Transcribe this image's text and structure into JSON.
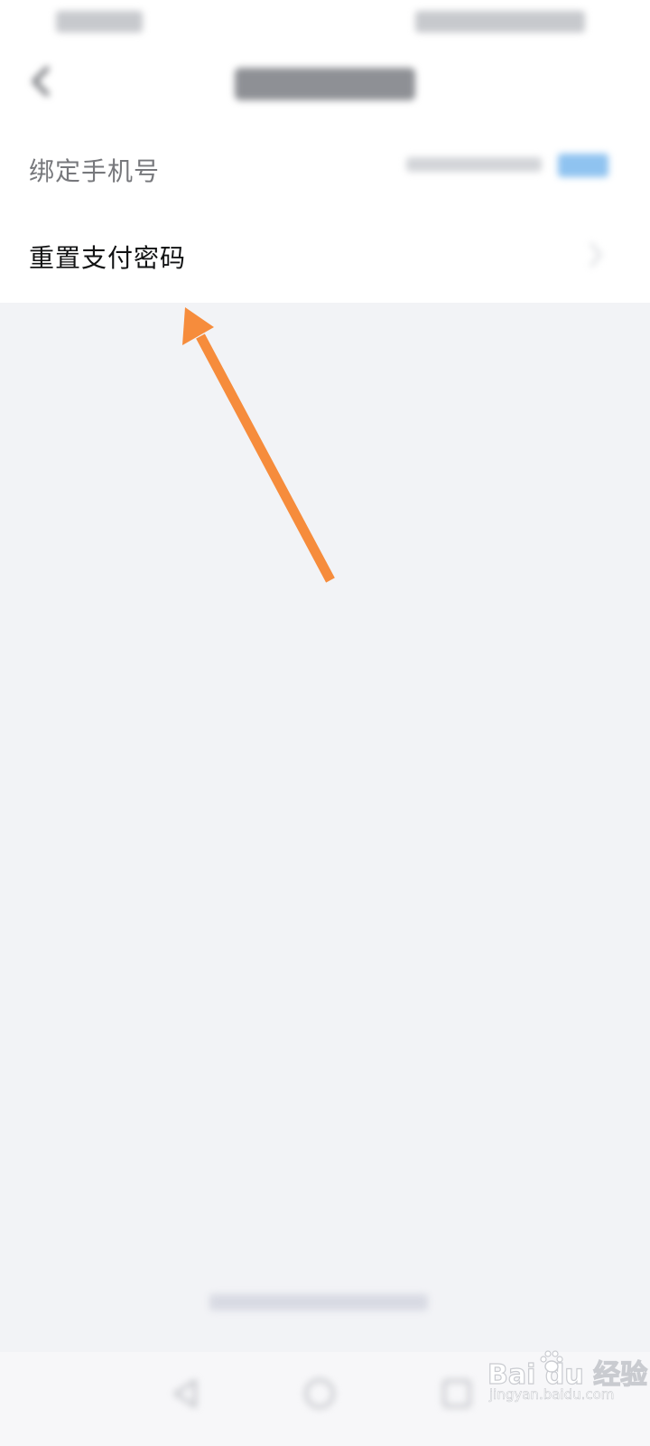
{
  "settings": {
    "bind_phone_label": "绑定手机号",
    "reset_pay_password_label": "重置支付密码"
  },
  "watermark": {
    "brand_text": "Bai du 经验",
    "url_text": "jingyan.baidu.com"
  },
  "icons": {
    "back": "chevron-left-icon",
    "row_arrow": "chevron-right-icon",
    "annotation": "arrow-icon",
    "nav_back": "triangle-back-icon",
    "nav_home": "circle-home-icon",
    "nav_recent": "square-recent-icon"
  },
  "colors": {
    "page_background": "#f2f3f6",
    "list_background": "#ffffff",
    "primary_text": "#111213",
    "secondary_text": "#77787c",
    "annotation_arrow": "#f68c3c",
    "tag_blue": "#8fc3f0"
  }
}
